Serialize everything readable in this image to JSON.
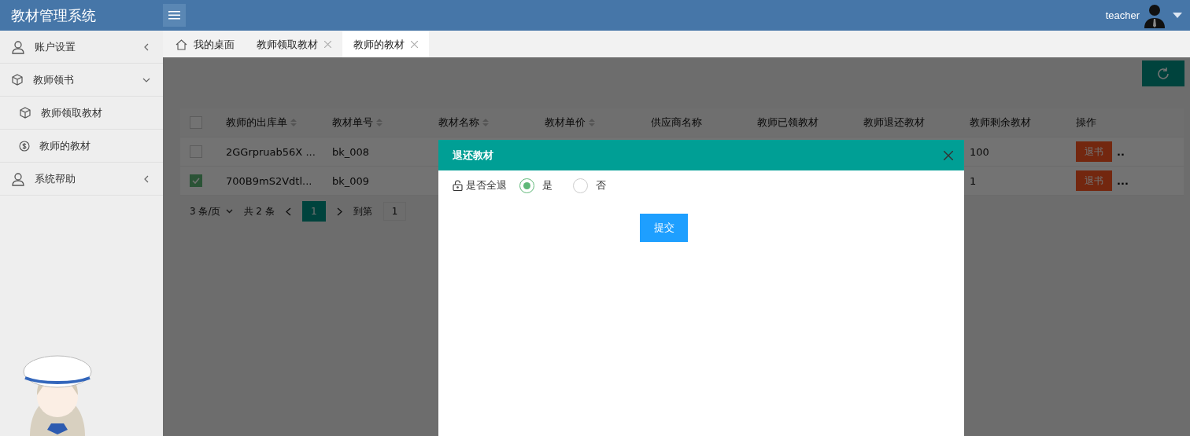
{
  "header": {
    "title": "教材管理系统",
    "user": "teacher"
  },
  "sidebar": {
    "items": [
      {
        "label": "账户设置",
        "kind": "user",
        "expanded": false
      },
      {
        "label": "教师领书",
        "kind": "box",
        "expanded": true,
        "children": [
          {
            "label": "教师领取教材",
            "kind": "box"
          },
          {
            "label": "教师的教材",
            "kind": "coin"
          }
        ]
      },
      {
        "label": "系统帮助",
        "kind": "user",
        "expanded": false
      }
    ]
  },
  "tabs": [
    {
      "label": "我的桌面",
      "kind": "home",
      "selected": false
    },
    {
      "label": "教师领取教材",
      "kind": "closable",
      "selected": false
    },
    {
      "label": "教师的教材",
      "kind": "closable",
      "selected": true
    }
  ],
  "table": {
    "select_all_checked": false,
    "columns": [
      {
        "label": "教师的出库单",
        "sortable": true
      },
      {
        "label": "教材单号",
        "sortable": true
      },
      {
        "label": "教材名称",
        "sortable": true
      },
      {
        "label": "教材单价",
        "sortable": true
      },
      {
        "label": "供应商名称",
        "sortable": false
      },
      {
        "label": "教师已领教材",
        "sortable": false
      },
      {
        "label": "教师退还教材",
        "sortable": false
      },
      {
        "label": "教师剩余教材",
        "sortable": false
      },
      {
        "label": "操作",
        "sortable": false
      }
    ],
    "rows": [
      {
        "checked": false,
        "cells": [
          "2GGrpruab56X ...",
          "bk_008",
          "",
          "",
          "",
          "",
          "",
          "100"
        ],
        "action": "退书",
        "more": ".."
      },
      {
        "checked": true,
        "cells": [
          "700B9mS2Vdtl...",
          "bk_009",
          "",
          "",
          "",
          "",
          "",
          "1"
        ],
        "action": "退书",
        "more": "..."
      }
    ],
    "pagination": {
      "page_size": "3 条/页",
      "total": "共 2 条",
      "current": "1",
      "goto_label": "到第",
      "goto_value": "1"
    }
  },
  "dialog": {
    "title": "退还教材",
    "field_label": "是否全退",
    "options": [
      {
        "label": "是",
        "selected": true
      },
      {
        "label": "否",
        "selected": false
      }
    ],
    "submit": "提交"
  }
}
